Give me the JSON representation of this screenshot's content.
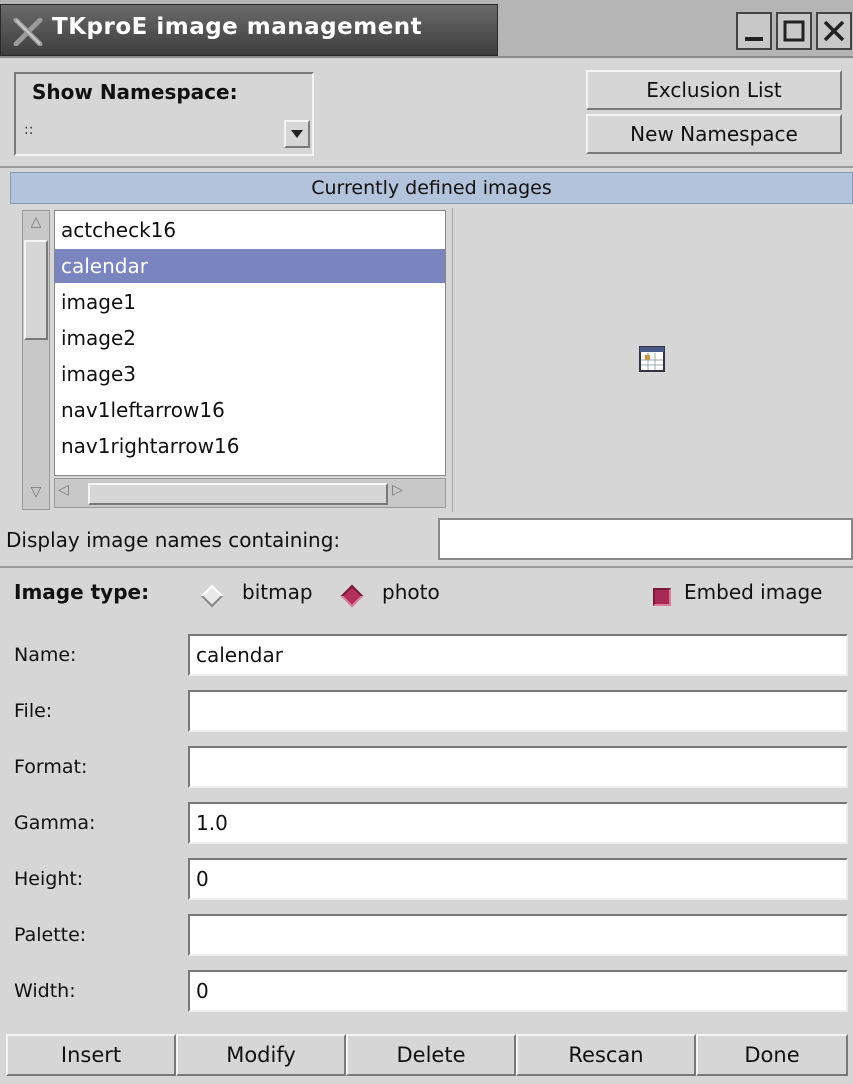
{
  "window": {
    "title": "TKproE image management",
    "app_icon": "x-tools-icon",
    "controls": [
      "minimize-icon",
      "maximize-icon",
      "close-icon"
    ]
  },
  "namespace": {
    "label": "Show Namespace:",
    "value": "::",
    "exclusion_button": "Exclusion List",
    "new_namespace_button": "New Namespace"
  },
  "images": {
    "header": "Currently defined images",
    "items": [
      "actcheck16",
      "calendar",
      "image1",
      "image2",
      "image3",
      "nav1leftarrow16",
      "nav1rightarrow16"
    ],
    "selected": "calendar",
    "filter_label": "Display image names containing:",
    "filter_value": ""
  },
  "image_type": {
    "label": "Image type:",
    "options": [
      "bitmap",
      "photo"
    ],
    "selected": "photo",
    "embed_label": "Embed image",
    "embed_checked": true
  },
  "fields": {
    "name": {
      "label": "Name:",
      "value": "calendar"
    },
    "file": {
      "label": "File:",
      "value": ""
    },
    "format": {
      "label": "Format:",
      "value": ""
    },
    "gamma": {
      "label": "Gamma:",
      "value": "1.0"
    },
    "height": {
      "label": "Height:",
      "value": "0"
    },
    "palette": {
      "label": "Palette:",
      "value": ""
    },
    "width": {
      "label": "Width:",
      "value": "0"
    }
  },
  "buttons": {
    "insert": "Insert",
    "modify": "Modify",
    "delete": "Delete",
    "rescan": "Rescan",
    "done": "Done"
  },
  "colors": {
    "selection": "#7a84bf",
    "header": "#b3c3dc",
    "accent": "#a62a55"
  }
}
